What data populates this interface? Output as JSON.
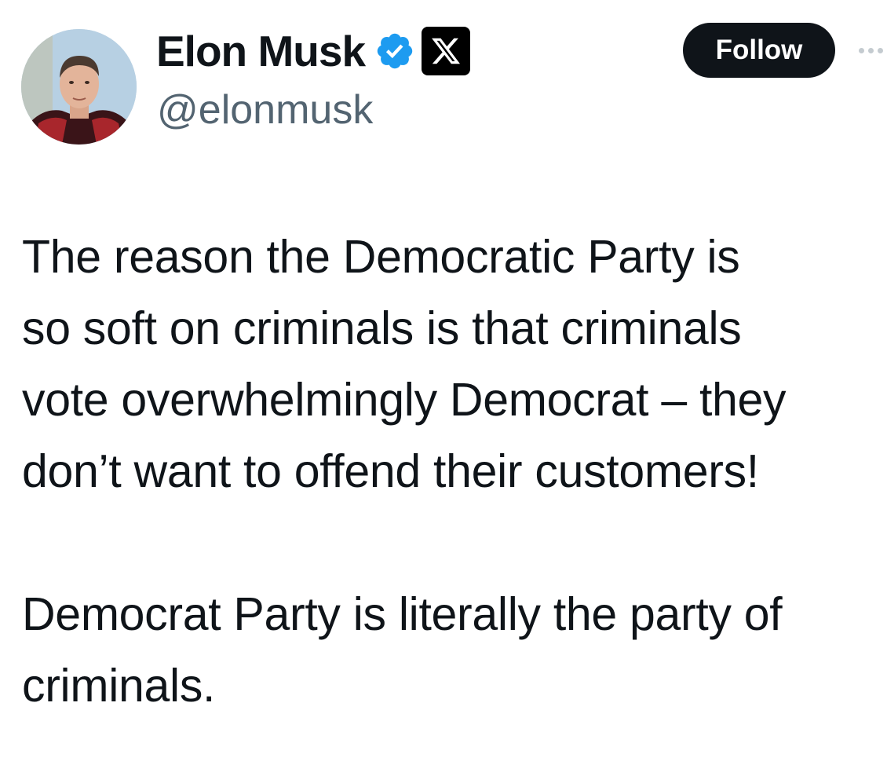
{
  "author": {
    "display_name": "Elon Musk",
    "handle": "@elonmusk",
    "verified": true,
    "verified_color": "#1d9bf0",
    "affiliate_badge_icon": "x-logo-icon",
    "avatar_icon": "profile-photo"
  },
  "actions": {
    "follow_label": "Follow",
    "more_icon": "more-options-icon"
  },
  "tweet": {
    "paragraph_1": [
      "The reason the Democratic Party is",
      "so soft on criminals is that criminals",
      "vote overwhelmingly Democrat – they",
      "don’t want to offend their customers!"
    ],
    "paragraph_2": [
      "Democrat Party is literally the party of",
      "criminals."
    ]
  },
  "colors": {
    "text": "#0f1419",
    "secondary_text": "#536471",
    "follow_button_bg": "#0f1419",
    "follow_button_text": "#ffffff"
  }
}
